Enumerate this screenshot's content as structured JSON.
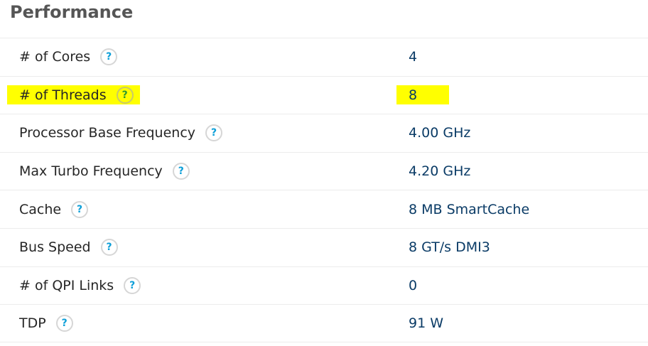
{
  "section": {
    "title": "Performance"
  },
  "help_icon": {
    "glyph": "?",
    "name": "question-mark-icon"
  },
  "highlight_color": "#ffff00",
  "specs": [
    {
      "label": "# of Cores",
      "value": "4",
      "highlighted": false
    },
    {
      "label": "# of Threads",
      "value": "8",
      "highlighted": true
    },
    {
      "label": "Processor Base Frequency",
      "value": "4.00 GHz",
      "highlighted": false
    },
    {
      "label": "Max Turbo Frequency",
      "value": "4.20 GHz",
      "highlighted": false
    },
    {
      "label": "Cache",
      "value": "8 MB SmartCache",
      "highlighted": false
    },
    {
      "label": "Bus Speed",
      "value": "8 GT/s DMI3",
      "highlighted": false
    },
    {
      "label": "# of QPI Links",
      "value": "0",
      "highlighted": false
    },
    {
      "label": "TDP",
      "value": "91 W",
      "highlighted": false
    }
  ]
}
